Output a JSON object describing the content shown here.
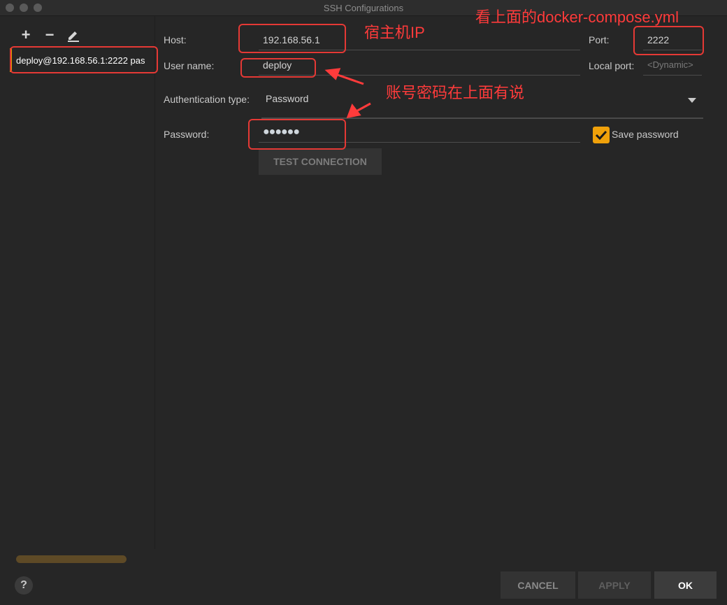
{
  "window": {
    "title": "SSH Configurations"
  },
  "sidebar": {
    "tools": {
      "add": "+",
      "remove": "−",
      "edit_icon": "pencil-icon"
    },
    "items": [
      {
        "label": "deploy@192.168.56.1:2222 pas"
      }
    ]
  },
  "form": {
    "host_label": "Host:",
    "host_value": "192.168.56.1",
    "port_label": "Port:",
    "port_value": "2222",
    "username_label": "User name:",
    "username_value": "deploy",
    "local_port_label": "Local port:",
    "local_port_placeholder": "<Dynamic>",
    "auth_label": "Authentication type:",
    "auth_value": "Password",
    "password_label": "Password:",
    "password_value": "●●●●●●",
    "save_password_label": "Save password",
    "save_password_checked": true,
    "test_connection_label": "TEST CONNECTION"
  },
  "footer": {
    "help_label": "?",
    "cancel_label": "CANCEL",
    "apply_label": "APPLY",
    "ok_label": "OK"
  },
  "annotations": {
    "host_note": "宿主机IP",
    "port_note": "看上面的docker-compose.yml",
    "account_note": "账号密码在上面有说"
  },
  "colors": {
    "accent": "#f0a10a",
    "annotation_red": "#e53935",
    "background": "#262626"
  }
}
